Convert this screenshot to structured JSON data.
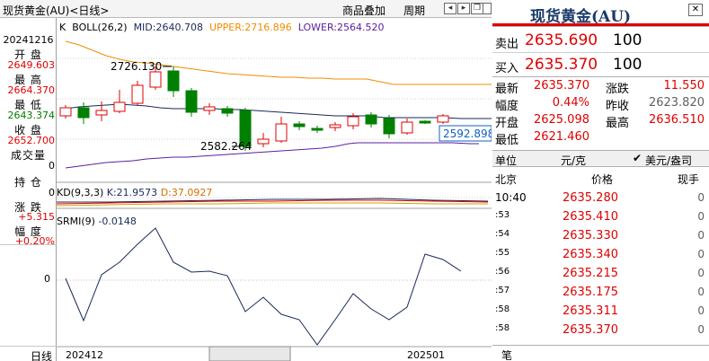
{
  "toolbar": {
    "title": "现货黄金(AU)<日线>",
    "overlay_label": "商品叠加",
    "period_label": "周期"
  },
  "left": {
    "date": "20241216",
    "open_label": "开 盘",
    "open_value": "2649.603",
    "high_label": "最 高",
    "high_value": "2664.370",
    "low_label": "最 低",
    "low_value": "2643.374",
    "close_label": "收 盘",
    "close_value": "2652.700",
    "volume_label": "成交量",
    "volume_value": "0",
    "hold_label": "持 仓",
    "hold_value": "0",
    "change_label": "涨 跌",
    "change_value": "+5.315",
    "pct_label": "幅 度",
    "pct_value": "+0.20%",
    "bottom_label": "日线"
  },
  "chart": {
    "boll_k": "K",
    "boll_name": "BOLL(26,2)",
    "mid": "MID:2640.708",
    "upper": "UPPER:2716.896",
    "lower": "LOWER:2564.520",
    "high_mark": "2726.130",
    "low_mark": "2582.264",
    "price_tag": "2592.898",
    "kd_name": "KD(9,3,3)",
    "kd_k": "K:21.9573",
    "kd_d": "D:37.0927",
    "srmi_name": "SRMI(9)",
    "srmi_value": "-0.0148",
    "srmi_zero": "0",
    "axis_start": "202412",
    "axis_end": "202501",
    "colors": {
      "upper": "#f28c00",
      "mid": "#1a2a5a",
      "lower": "#5a20a0",
      "up": "#e00000",
      "down": "#008000"
    }
  },
  "right": {
    "title": "现货黄金(AU)",
    "sell_label": "卖出",
    "sell_price": "2635.690",
    "sell_qty": "100",
    "buy_label": "买入",
    "buy_price": "2635.370",
    "buy_qty": "100",
    "stats": [
      {
        "l1": "最新",
        "v1": "2635.370",
        "c1": "red",
        "l2": "涨跌",
        "v2": "11.550",
        "c2": "red"
      },
      {
        "l1": "幅度",
        "v1": "0.44%",
        "c1": "red",
        "l2": "昨收",
        "v2": "2623.820",
        "c2": "gray"
      },
      {
        "l1": "开盘",
        "v1": "2625.098",
        "c1": "red",
        "l2": "最高",
        "v2": "2636.510",
        "c2": "red"
      },
      {
        "l1": "最低",
        "v1": "2621.460",
        "c1": "red",
        "l2": "",
        "v2": "",
        "c2": "gray"
      }
    ],
    "unit_label": "单位",
    "unit_value": "元/克",
    "unit_toggle": "美元/盎司",
    "ticks_headers": [
      "北京",
      "价格",
      "现手"
    ],
    "ticks": [
      {
        "time": "10:40",
        "price": "2635.280",
        "qty": "0"
      },
      {
        "time": ":53",
        "price": "2635.410",
        "qty": "0"
      },
      {
        "time": ":54",
        "price": "2635.330",
        "qty": "0"
      },
      {
        "time": ":55",
        "price": "2635.340",
        "qty": "0"
      },
      {
        "time": ":56",
        "price": "2635.215",
        "qty": "0"
      },
      {
        "time": ":57",
        "price": "2635.175",
        "qty": "0"
      },
      {
        "time": ":58",
        "price": "2635.311",
        "qty": "0"
      },
      {
        "time": ":58",
        "price": "2635.370",
        "qty": "0"
      }
    ],
    "bottom_label": "笔"
  }
}
